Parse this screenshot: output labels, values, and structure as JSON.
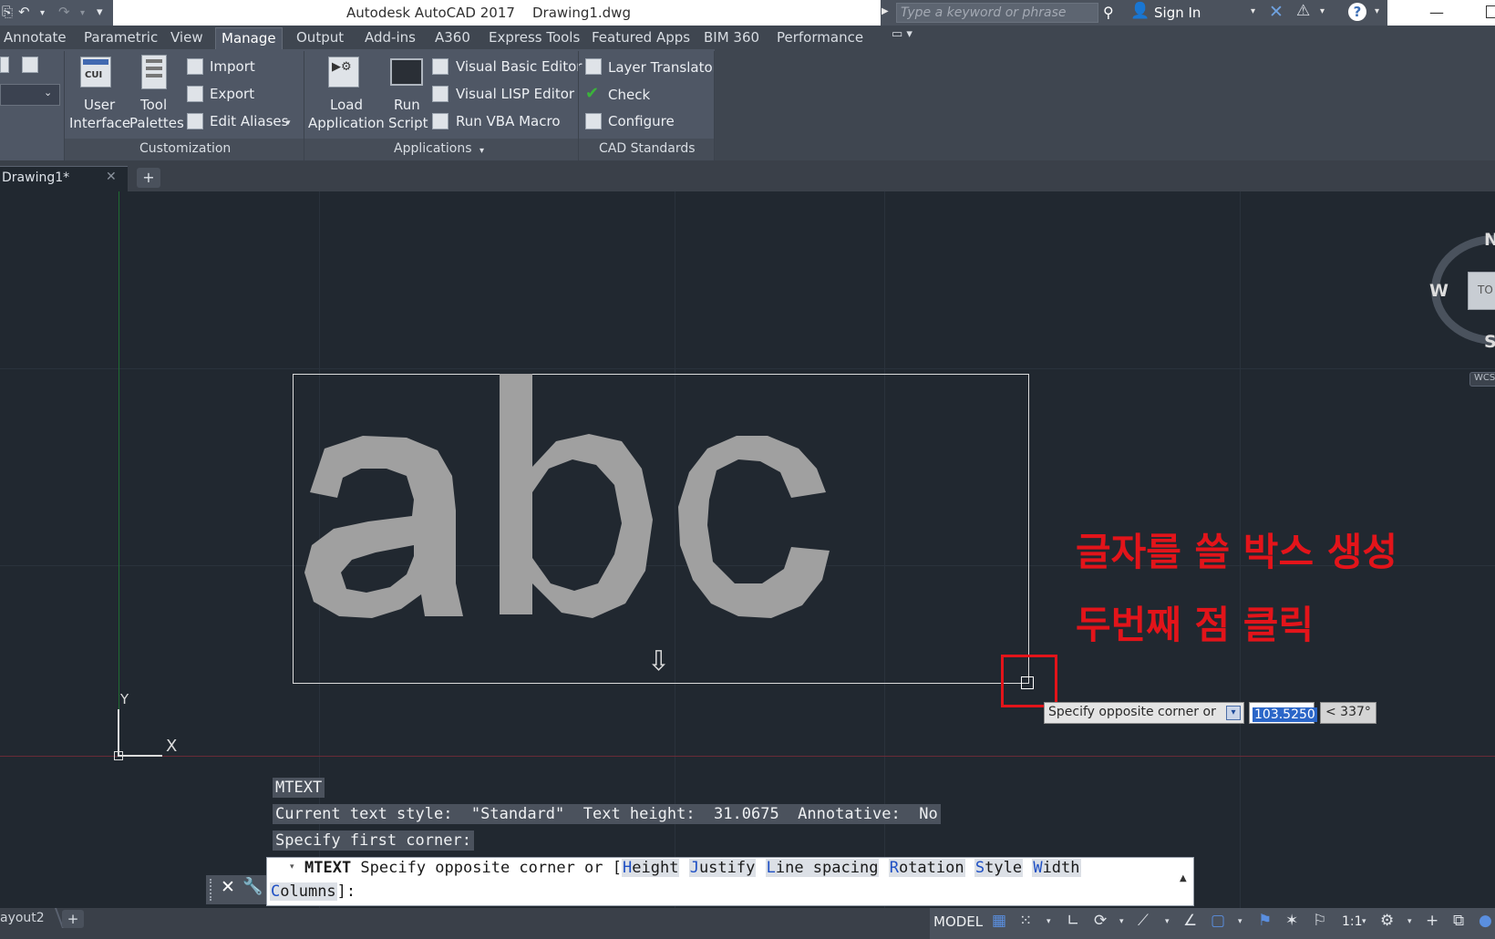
{
  "title_bar": {
    "title": "Autodesk AutoCAD 2017    Drawing1.dwg",
    "search_placeholder": "Type a keyword or phrase",
    "sign_in": "Sign In",
    "help": "?",
    "minimize": "—"
  },
  "qat": {
    "undo": "↶",
    "redo": "↷",
    "drop": "▾",
    "customize": "▾"
  },
  "ribbon_tabs": [
    "Annotate",
    "Parametric",
    "View",
    "Manage",
    "Output",
    "Add-ins",
    "A360",
    "Express Tools",
    "Featured Apps",
    "BIM 360",
    "Performance"
  ],
  "active_tab": "Manage",
  "ribbon": {
    "customization": {
      "title": "Customization",
      "user_interface": [
        "User",
        "Interface"
      ],
      "tool_palettes": [
        "Tool",
        "Palettes"
      ],
      "import": "Import",
      "export": "Export",
      "edit_aliases": "Edit Aliases",
      "cui_badge": "CUI"
    },
    "applications": {
      "title": "Applications",
      "load_application": [
        "Load",
        "Application"
      ],
      "run_script": [
        "Run",
        "Script"
      ],
      "visual_basic_editor": "Visual Basic Editor",
      "visual_lisp_editor": "Visual LISP Editor",
      "run_vba_macro": "Run VBA Macro"
    },
    "cad_standards": {
      "title": "CAD Standards",
      "layer_translator": "Layer Translator",
      "check": "Check",
      "configure": "Configure"
    }
  },
  "file_tab": {
    "label": "Drawing1*",
    "close": "✕",
    "new": "+"
  },
  "drawing": {
    "mtext_preview": "abc",
    "annotation_line1": "글자를 쓸 박스 생성",
    "annotation_line2": "두번째 점 클릭",
    "dynamic_input": {
      "prompt": "Specify opposite corner or",
      "value": "103.5250",
      "angle": "< 337°"
    },
    "ucs": {
      "x": "X",
      "y": "Y"
    },
    "viewcube": {
      "north": "N",
      "west": "W",
      "south": "S",
      "face": "TO",
      "wcs": "WCS"
    }
  },
  "command_history": [
    "MTEXT",
    "Current text style:  \"Standard\"  Text height:  31.0675  Annotative:  No",
    "Specify first corner:"
  ],
  "command_line": {
    "command": "MTEXT",
    "prompt": " Specify opposite corner or [",
    "options": [
      "Height",
      "Justify",
      "Line spacing",
      "Rotation",
      "Style",
      "Width",
      "Columns"
    ],
    "option_keys": [
      "H",
      "J",
      "L",
      "R",
      "S",
      "W",
      "C"
    ],
    "end": "]:"
  },
  "status_bar": {
    "layout_tab": "ayout2",
    "add_layout": "+",
    "model": "MODEL",
    "scale": "1:1"
  }
}
